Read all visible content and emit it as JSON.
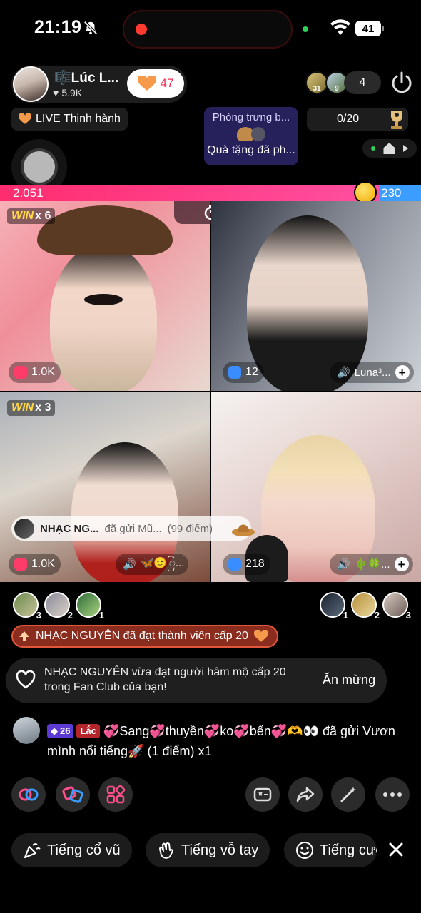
{
  "status_bar": {
    "time": "21:19",
    "battery": "41"
  },
  "host": {
    "name": "Lúc L...",
    "likes": "5.9K",
    "follow_count": "47"
  },
  "viewers": {
    "avatar_1_badge": "31",
    "avatar_2_badge": "9",
    "count": "4"
  },
  "trending": {
    "label": "LIVE Thịnh hành"
  },
  "gift_room": {
    "title": "Phòng trưng b...",
    "subtitle": "Quà tặng đã ph..."
  },
  "goal": {
    "progress": "0/20"
  },
  "pk_bar": {
    "left_score": "2.051",
    "right_score": "230",
    "left_share": 0.9
  },
  "grid": {
    "cells": [
      {
        "win_label": "WIN",
        "win_count": "x 6",
        "stat": "1.0K"
      },
      {
        "stat": "12",
        "name": "Luna³..."
      },
      {
        "win_label": "WIN",
        "win_count": "x 3",
        "stat": "1.0K",
        "name": "🦋🙂ြ..."
      },
      {
        "stat": "218",
        "name": "🌵🍀..."
      }
    ]
  },
  "gift_banner": {
    "sender": "NHẠC NG...",
    "action": "đã gửi Mũ...",
    "points": "(99 điểm)"
  },
  "contributors": {
    "left": [
      "3",
      "2",
      "1"
    ],
    "right": [
      "1",
      "2",
      "3"
    ]
  },
  "level_notice": {
    "text": "NHẠC NGUYÊN đã đạt thành viên cấp 20"
  },
  "fan_notice": {
    "text": "NHẠC NGUYÊN vừa đạt người hâm mộ cấp 20 trong Fan Club của bạn!",
    "button": "Ăn mừng"
  },
  "chat": {
    "level": "26",
    "club_badge": "Lắc",
    "message_part1": "Sang",
    "message_part2": "thuyền",
    "message_part3": "ko",
    "message_part4": "bến",
    "message_part5": "👀 đã gửi Vươn mình nổi tiếng",
    "message_part6": "(1 điểm) x1"
  },
  "reactions": {
    "cheer": "Tiếng cổ vũ",
    "clap": "Tiếng vỗ tay",
    "laugh": "Tiếng cười"
  },
  "colors": {
    "accent_pink": "#ff2d6f",
    "accent_blue": "#3a9dff",
    "level_pill": "#8a2c1e"
  }
}
